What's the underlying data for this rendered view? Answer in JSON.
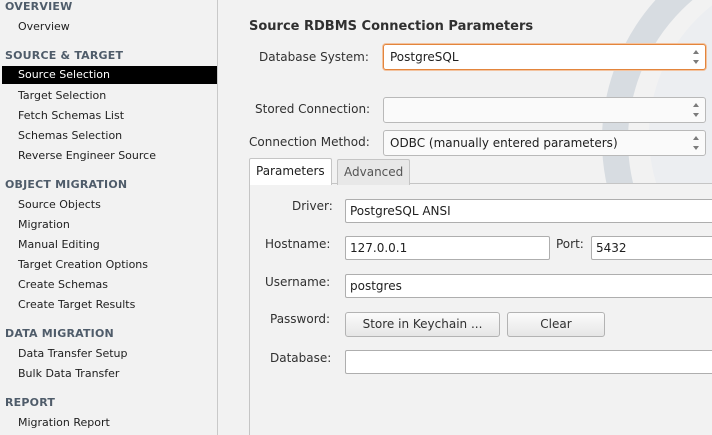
{
  "sidebar": {
    "sections": [
      {
        "title": "OVERVIEW",
        "items": [
          "Overview"
        ]
      },
      {
        "title": "SOURCE & TARGET",
        "items": [
          "Source Selection",
          "Target Selection",
          "Fetch Schemas List",
          "Schemas Selection",
          "Reverse Engineer Source"
        ]
      },
      {
        "title": "OBJECT MIGRATION",
        "items": [
          "Source Objects",
          "Migration",
          "Manual Editing",
          "Target Creation Options",
          "Create Schemas",
          "Create Target Results"
        ]
      },
      {
        "title": "DATA MIGRATION",
        "items": [
          "Data Transfer Setup",
          "Bulk Data Transfer"
        ]
      },
      {
        "title": "REPORT",
        "items": [
          "Migration Report"
        ]
      }
    ],
    "active_item": "Source Selection"
  },
  "main": {
    "title": "Source RDBMS Connection Parameters",
    "database_system": {
      "label": "Database System:",
      "value": "PostgreSQL"
    },
    "stored_connection": {
      "label": "Stored Connection:",
      "value": ""
    },
    "connection_method": {
      "label": "Connection Method:",
      "value": "ODBC (manually entered parameters)"
    },
    "tabs": [
      "Parameters",
      "Advanced"
    ],
    "active_tab": "Parameters",
    "params": {
      "driver_label": "Driver:",
      "driver_value": "PostgreSQL ANSI",
      "hostname_label": "Hostname:",
      "hostname_value": "127.0.0.1",
      "port_label": "Port:",
      "port_value": "5432",
      "username_label": "Username:",
      "username_value": "postgres",
      "password_label": "Password:",
      "store_keychain_label": "Store in Keychain ...",
      "clear_label": "Clear",
      "database_label": "Database:",
      "database_value": ""
    }
  },
  "colors": {
    "active_bg": "#000000",
    "section_header": "#4f5c6a",
    "focus_border": "#e3853c"
  }
}
